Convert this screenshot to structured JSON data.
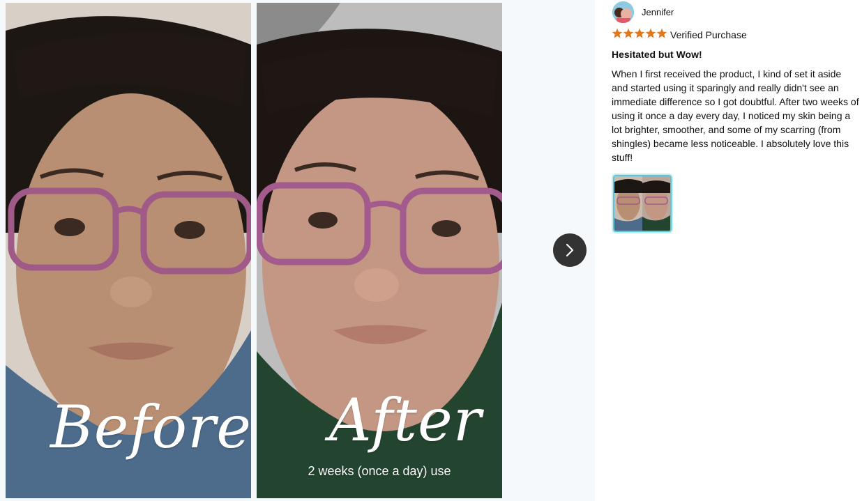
{
  "viewer": {
    "before_label": "Before",
    "after_label": "After",
    "after_caption": "2 weeks (once a day) use",
    "next_icon": "chevron-right-icon"
  },
  "review": {
    "reviewer_name": "Jennifer",
    "rating": 5,
    "rating_max": 5,
    "verified_label": "Verified Purchase",
    "title": "Hesitated but Wow!",
    "body": "When I first received the product, I kind of set it aside and started using it sparingly and really didn't see an immediate difference so I got doubtful. After two weeks of using it once a day every day, I noticed my skin being a lot brighter, smoother, and some of my scarring (from shingles) became less noticeable. I absolutely love this stuff!",
    "star_color": "#de7921",
    "thumbnail_highlight": "#5fc4d6"
  }
}
